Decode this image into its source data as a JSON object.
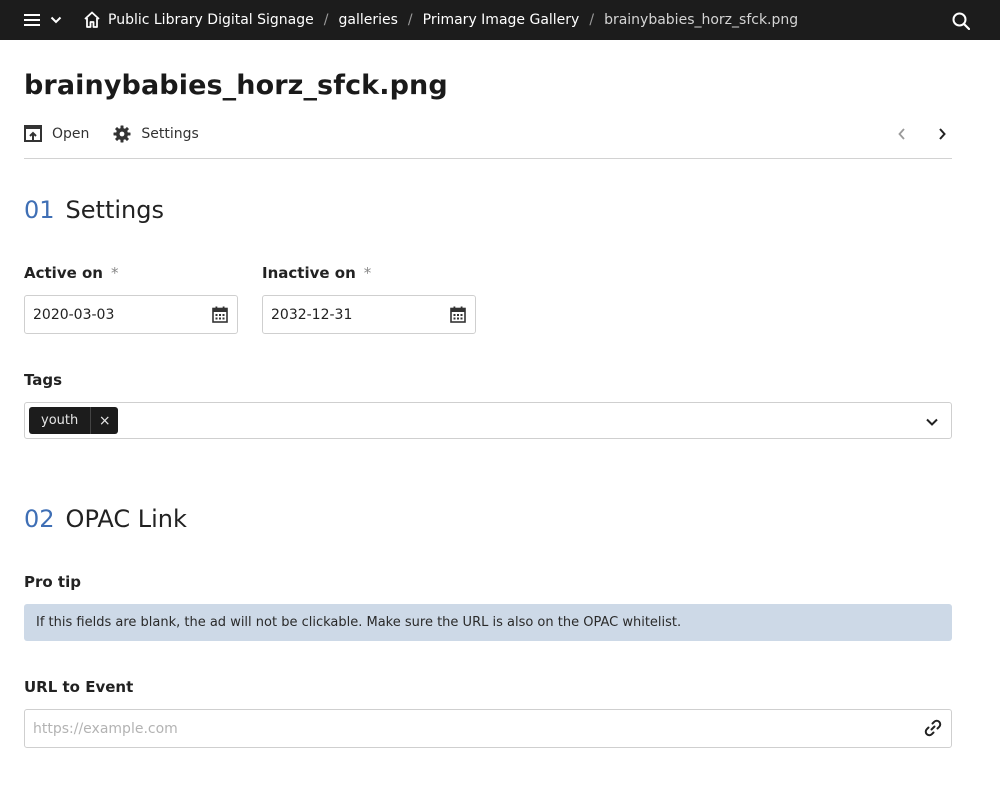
{
  "topbar": {
    "menu_icon": "hamburger-icon",
    "dropdown_icon": "chevron-down-icon",
    "home_icon": "home-icon",
    "search_icon": "search-icon",
    "breadcrumbs": [
      "Public Library Digital Signage",
      "galleries",
      "Primary Image Gallery",
      "brainybabies_horz_sfck.png"
    ],
    "separator": "/"
  },
  "header": {
    "title": "brainybabies_horz_sfck.png",
    "toolbar": {
      "open_label": "Open",
      "settings_label": "Settings"
    }
  },
  "settings_section": {
    "number": "01",
    "title": "Settings",
    "active_on": {
      "label": "Active on",
      "required": "*",
      "value": "2020-03-03"
    },
    "inactive_on": {
      "label": "Inactive on",
      "required": "*",
      "value": "2032-12-31"
    },
    "tags": {
      "label": "Tags",
      "items": [
        "youth"
      ],
      "remove_symbol": "×"
    }
  },
  "opac_section": {
    "number": "02",
    "title": "OPAC Link",
    "pro_tip": {
      "label": "Pro tip",
      "text": "If this fields are blank, the ad will not be clickable. Make sure the URL is also on the OPAC whitelist."
    },
    "url": {
      "label": "URL to Event",
      "value": "",
      "placeholder": "https://example.com"
    }
  },
  "colors": {
    "topbar_bg": "#1c1c1c",
    "section_number": "#3f6fb5",
    "protip_bg": "#cdd9e7",
    "tag_bg": "#1c1c1c"
  }
}
